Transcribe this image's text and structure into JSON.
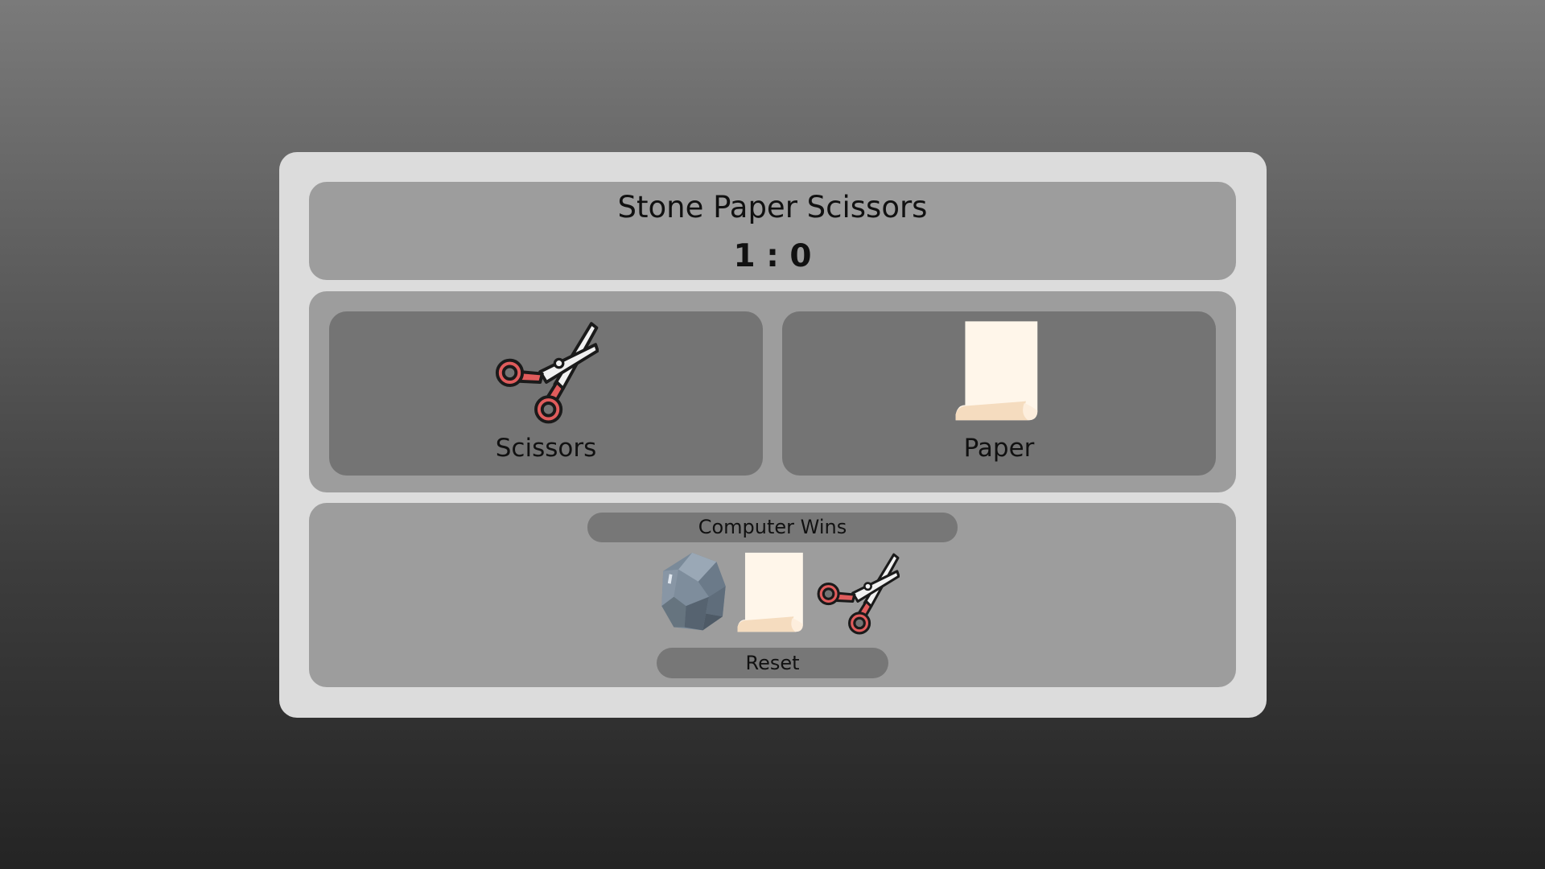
{
  "header": {
    "title": "Stone Paper Scissors",
    "score": "1 : 0"
  },
  "choices": {
    "player": {
      "label": "Scissors",
      "icon": "scissors-icon"
    },
    "computer": {
      "label": "Paper",
      "icon": "paper-icon"
    }
  },
  "result": {
    "status": "Computer Wins",
    "options": [
      {
        "name": "stone",
        "icon": "stone-icon"
      },
      {
        "name": "paper",
        "icon": "paper-icon"
      },
      {
        "name": "scissors",
        "icon": "scissors-icon"
      }
    ],
    "reset_label": "Reset"
  },
  "colors": {
    "card": "#dcdcdc",
    "panel": "#9d9d9d",
    "choice_tile": "#747474",
    "pill": "#777777",
    "scissors_handle": "#e05c5c",
    "paper": "#fff6ea",
    "stone": "#6f7e8d"
  }
}
